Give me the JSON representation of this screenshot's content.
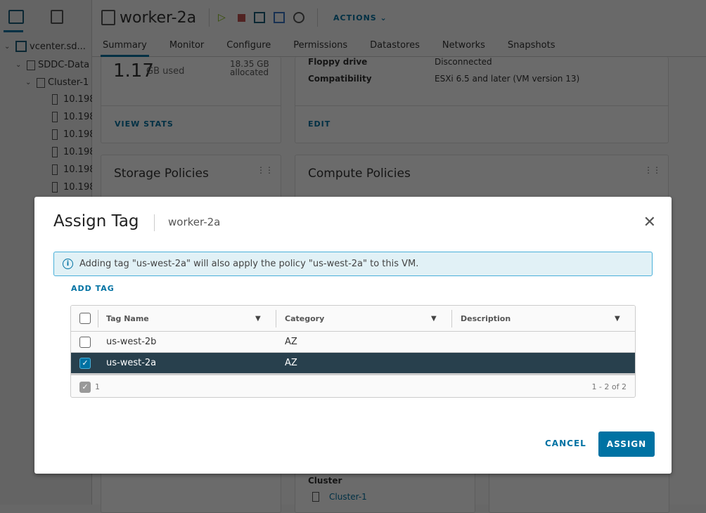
{
  "sidebar": {
    "tree": [
      {
        "label": "vcenter.sd..."
      },
      {
        "label": "SDDC-Data"
      },
      {
        "label": "Cluster-1"
      },
      {
        "label": "10.198"
      },
      {
        "label": "10.198"
      },
      {
        "label": "10.198"
      },
      {
        "label": "10.198"
      },
      {
        "label": "10.198"
      },
      {
        "label": "10.198"
      }
    ]
  },
  "header": {
    "title": "worker-2a",
    "actions_label": "ACTIONS"
  },
  "tabs": [
    {
      "label": "Summary"
    },
    {
      "label": "Monitor"
    },
    {
      "label": "Configure"
    },
    {
      "label": "Permissions"
    },
    {
      "label": "Datastores"
    },
    {
      "label": "Networks"
    },
    {
      "label": "Snapshots"
    }
  ],
  "cards": {
    "storage": {
      "used_value": "1.17",
      "used_unit": "GB used",
      "allocated": "18.35 GB",
      "allocated_label": "allocated",
      "link": "VIEW STATS"
    },
    "vm_hw": {
      "rows": [
        {
          "label": "Floppy drive",
          "value": "Disconnected"
        },
        {
          "label": "Compatibility",
          "value": "ESXi 6.5 and later (VM version 13)"
        }
      ],
      "link": "EDIT"
    },
    "storage_policies": {
      "title": "Storage Policies"
    },
    "compute_policies": {
      "title": "Compute Policies"
    },
    "related": {
      "cluster_label": "Cluster",
      "cluster_value": "Cluster-1"
    }
  },
  "dialog": {
    "title": "Assign Tag",
    "subtitle": "worker-2a",
    "alert": "Adding tag \"us-west-2a\" will also apply the policy \"us-west-2a\" to this VM.",
    "add_tag": "ADD TAG",
    "columns": [
      "Tag Name",
      "Category",
      "Description"
    ],
    "rows": [
      {
        "name": "us-west-2b",
        "category": "AZ",
        "description": "",
        "selected": false
      },
      {
        "name": "us-west-2a",
        "category": "AZ",
        "description": "",
        "selected": true
      }
    ],
    "selected_count": "1",
    "pagination": "1 - 2 of 2",
    "cancel": "CANCEL",
    "assign": "ASSIGN"
  },
  "colors": {
    "accent": "#0072a3",
    "selected_row": "#28404d",
    "alert_bg": "#e1f1f6"
  }
}
